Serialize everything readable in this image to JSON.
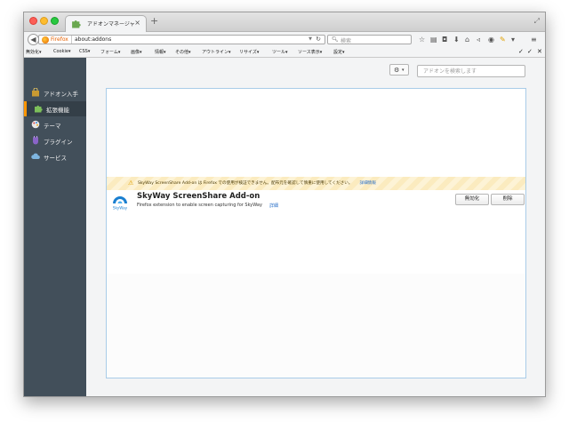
{
  "tab": {
    "title": "アドオンマネージャ",
    "close": "×",
    "new_tab": "+"
  },
  "navbar": {
    "url_brand": "Firefox",
    "url": "about:addons",
    "search_placeholder": "検索"
  },
  "devbar": {
    "items": [
      "無効化▾",
      "Cookie▾",
      "CSS▾",
      "フォーム▾",
      "画像▾",
      "情報▾",
      "その他▾",
      "アウトライン▾",
      "リサイズ▾",
      "ツール▾",
      "ソース表示▾",
      "設定▾"
    ],
    "checks": [
      "✓",
      "✓",
      "✕"
    ]
  },
  "sidebar": {
    "items": [
      {
        "label": "アドオン入手",
        "icon": "shopping-bag-icon"
      },
      {
        "label": "拡張機能",
        "icon": "puzzle-piece-icon",
        "selected": true
      },
      {
        "label": "テーマ",
        "icon": "palette-icon"
      },
      {
        "label": "プラグイン",
        "icon": "plugin-icon"
      },
      {
        "label": "サービス",
        "icon": "cloud-service-icon"
      }
    ]
  },
  "main": {
    "search_placeholder": "アドオンを検索します",
    "warning": {
      "text": "SkyWay ScreenShare Add-on は Firefox での使用が検証できません。配布元を確認して慎重に使用してください。",
      "link": "詳細情報"
    },
    "addon": {
      "name": "SkyWay ScreenShare Add-on",
      "description": "Firefox extension to enable screen capturing for SkyWay",
      "detail_link": "詳細",
      "icon_label": "SkyWay",
      "disable_label": "無効化",
      "remove_label": "削除"
    }
  },
  "colors": {
    "sidebar_bg": "#424f5a",
    "selected_accent": "#ff9500",
    "link": "#2a70c8",
    "warning_bg": "#fdf3d6"
  }
}
